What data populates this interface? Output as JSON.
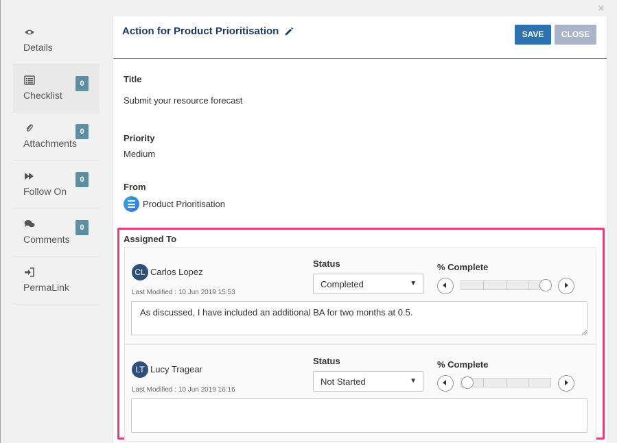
{
  "sidebar": {
    "items": [
      {
        "label": "Details",
        "icon": "eye-icon"
      },
      {
        "label": "Checklist",
        "icon": "checklist-icon",
        "badge": "0"
      },
      {
        "label": "Attachments",
        "icon": "paperclip-icon",
        "badge": "0"
      },
      {
        "label": "Follow On",
        "icon": "fast-forward-icon",
        "badge": "0"
      },
      {
        "label": "Comments",
        "icon": "comments-icon",
        "badge": "0"
      },
      {
        "label": "PermaLink",
        "icon": "sign-in-icon"
      }
    ]
  },
  "header": {
    "title": "Action for Product Prioritisation",
    "save_label": "SAVE",
    "close_label": "CLOSE"
  },
  "details": {
    "title_label": "Title",
    "title_value": "Submit your resource forecast",
    "priority_label": "Priority",
    "priority_value": "Medium",
    "from_label": "From",
    "from_value": "Product Prioritisation"
  },
  "assigned": {
    "label": "Assigned To",
    "assignees": [
      {
        "initials": "CL",
        "name": "Carlos Lopez",
        "last_modified": "Last Modified : 10 Jun 2019 15:53",
        "status_label": "Status",
        "status": "Completed",
        "percent_label": "% Complete",
        "percent_complete": 100,
        "comment": "As discussed, I have included an additional BA for two months at 0.5."
      },
      {
        "initials": "LT",
        "name": "Lucy Tragear",
        "last_modified": "Last Modified : 10 Jun 2019 16:16",
        "status_label": "Status",
        "status": "Not Started",
        "percent_label": "% Complete",
        "percent_complete": 0,
        "comment": ""
      }
    ]
  },
  "colors": {
    "primary": "#2d72ae",
    "badge": "#5d8fa4",
    "highlight": "#e0417a",
    "title": "#1f3a60"
  }
}
